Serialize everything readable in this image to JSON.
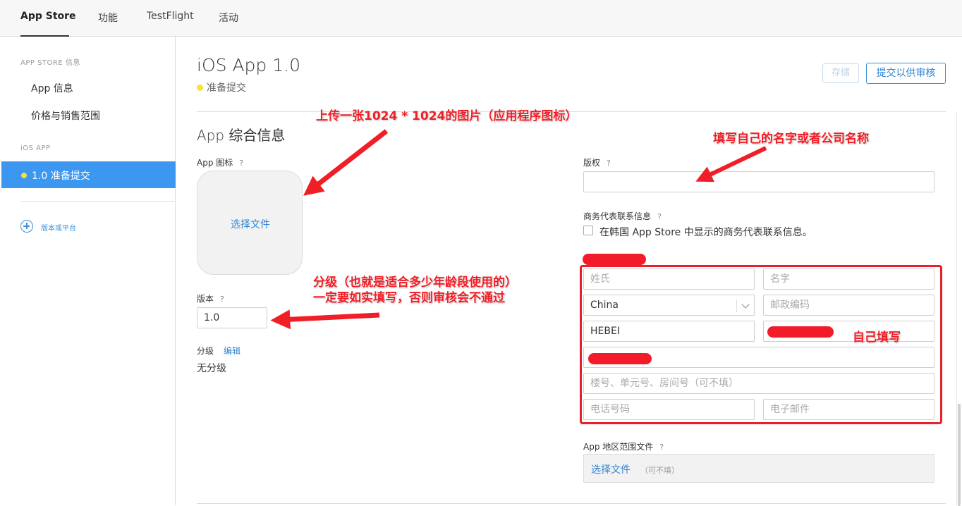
{
  "topbar": {
    "tabs": [
      {
        "label": "App Store"
      },
      {
        "label": "功能"
      },
      {
        "label": "TestFlight"
      },
      {
        "label": "活动"
      }
    ]
  },
  "sidebar": {
    "section1": "APP STORE 信息",
    "items": [
      {
        "label": "App 信息"
      },
      {
        "label": "价格与销售范围"
      }
    ],
    "section2": "iOS APP",
    "active_item": "1.0 准备提交",
    "add_label": "版本或平台"
  },
  "header": {
    "title": "iOS App 1.0",
    "status": "准备提交",
    "save_label": "存储",
    "submit_label": "提交以供审核"
  },
  "general": {
    "section_title": "App 综合信息",
    "icon_label": "App 图标",
    "help": "?",
    "choose_file": "选择文件",
    "version_label": "版本",
    "version_value": "1.0",
    "rating_label": "分级",
    "rating_edit": "编辑",
    "rating_value": "无分级",
    "copyright_label": "版权",
    "copyright_value": "",
    "contact_label": "商务代表联系信息",
    "contact_checkbox": "在韩国 App Store 中显示的商务代表联系信息。",
    "last_name_ph": "姓氏",
    "first_name_ph": "名字",
    "country": "China",
    "postcode_ph": "邮政编码",
    "province": "HEBEI",
    "address2_ph": "楼号、单元号、房间号（可不填）",
    "phone_ph": "电话号码",
    "email_ph": "电子邮件",
    "geo_label": "App 地区范围文件",
    "geo_choose": "选择文件",
    "geo_optional": "（可不填）"
  },
  "annotations": {
    "icon_note": "上传一张1024 * 1024的图片（应用程序图标）",
    "copyright_note": "填写自己的名字或者公司名称",
    "rating_note_line1": "分级（也就是适合多少年龄段使用的）",
    "rating_note_line2": "一定要如实填写，否则审核会不通过",
    "self_fill_note": "自己填写"
  },
  "colors": {
    "accent": "#3c97f1",
    "link": "#2f86d6",
    "status_dot": "#f4e13a",
    "annotation": "#f01e26"
  }
}
